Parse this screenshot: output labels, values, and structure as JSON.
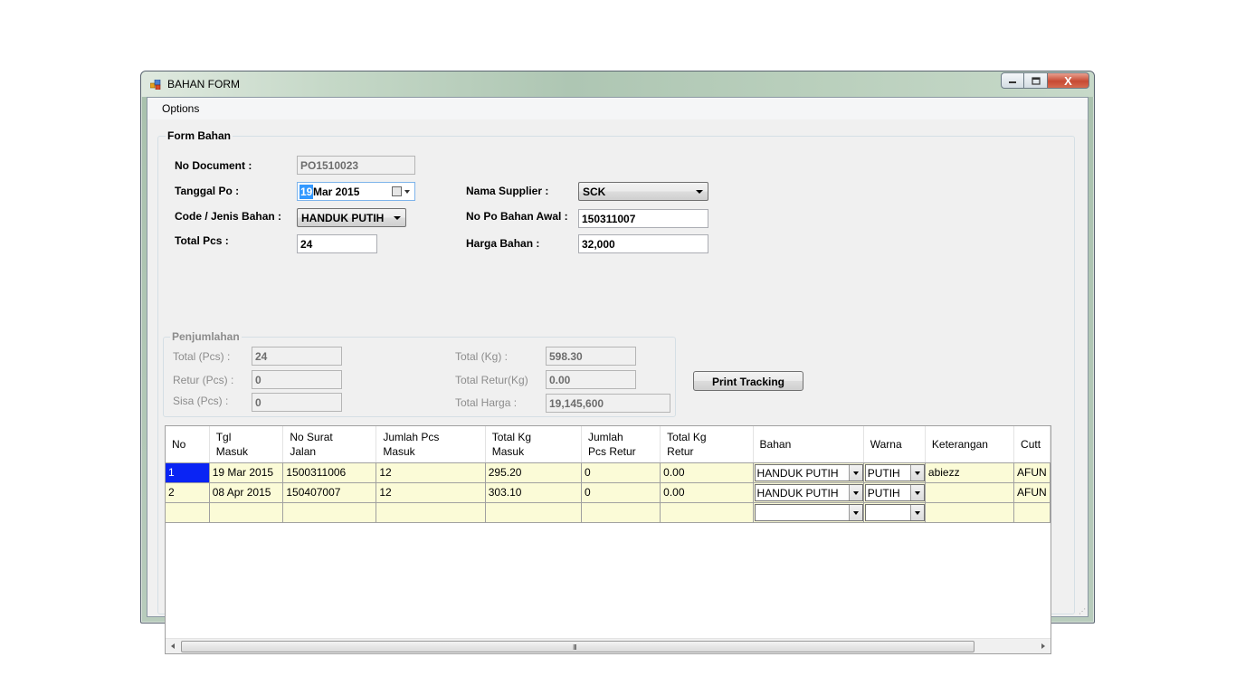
{
  "window": {
    "title": "BAHAN FORM",
    "controls": {
      "minimize": "—",
      "maximize": "□",
      "close": "X"
    }
  },
  "menu": {
    "options": "Options"
  },
  "form": {
    "group_title": "Form Bahan",
    "no_document": {
      "label": "No Document :",
      "value": "PO1510023"
    },
    "tanggal_po": {
      "label": "Tanggal Po :",
      "day": "19",
      "rest": "Mar 2015"
    },
    "code_jenis": {
      "label": "Code / Jenis Bahan :",
      "value": "HANDUK PUTIH"
    },
    "total_pcs": {
      "label": "Total Pcs :",
      "value": "24"
    },
    "nama_supplier": {
      "label": "Nama Supplier :",
      "value": "SCK"
    },
    "no_po_awal": {
      "label": "No Po Bahan Awal :",
      "value": "150311007"
    },
    "harga_bahan": {
      "label": "Harga Bahan :",
      "value": "32,000"
    }
  },
  "penjumlahan": {
    "title": "Penjumlahan",
    "total_pcs": {
      "label": "Total (Pcs) :",
      "value": "24"
    },
    "retur_pcs": {
      "label": "Retur (Pcs) :",
      "value": "0"
    },
    "sisa_pcs": {
      "label": "Sisa (Pcs) :",
      "value": "0"
    },
    "total_kg": {
      "label": "Total (Kg) :",
      "value": "598.30"
    },
    "total_retur_kg": {
      "label": "Total Retur(Kg)",
      "value": "0.00"
    },
    "total_harga": {
      "label": "Total Harga :",
      "value": "19,145,600"
    }
  },
  "buttons": {
    "print_tracking": "Print Tracking"
  },
  "grid": {
    "columns": [
      {
        "l1": "No",
        "l2": ""
      },
      {
        "l1": "Tgl",
        "l2": "Masuk"
      },
      {
        "l1": "No Surat",
        "l2": "Jalan"
      },
      {
        "l1": "Jumlah Pcs",
        "l2": "Masuk"
      },
      {
        "l1": "Total Kg",
        "l2": "Masuk"
      },
      {
        "l1": "Jumlah",
        "l2": "Pcs Retur"
      },
      {
        "l1": "Total Kg",
        "l2": "Retur"
      },
      {
        "l1": "Bahan",
        "l2": ""
      },
      {
        "l1": "Warna",
        "l2": ""
      },
      {
        "l1": "Keterangan",
        "l2": ""
      },
      {
        "l1": "Cutt",
        "l2": ""
      }
    ],
    "rows": [
      [
        "1",
        "19 Mar 2015",
        "1500311006",
        "12",
        "295.20",
        "0",
        "0.00",
        "HANDUK PUTIH",
        "PUTIH",
        "abiezz",
        "AFUN"
      ],
      [
        "2",
        "08 Apr 2015",
        "150407007",
        "12",
        "303.10",
        "0",
        "0.00",
        "HANDUK PUTIH",
        "PUTIH",
        "",
        "AFUN"
      ],
      [
        "",
        "",
        "",
        "",
        "",
        "",
        "",
        "",
        "",
        "",
        ""
      ]
    ],
    "scroll_grip": "III"
  }
}
